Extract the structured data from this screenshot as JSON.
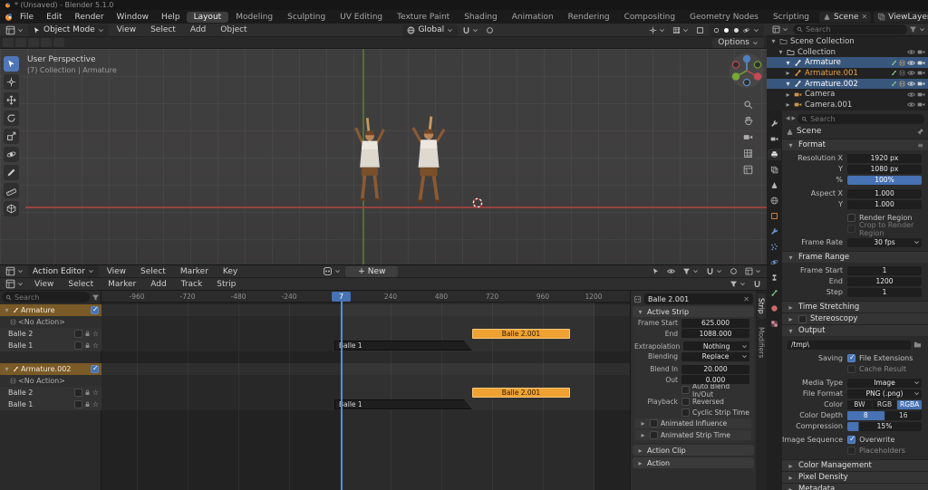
{
  "window": {
    "title": "* (Unsaved) - Blender 5.1.0"
  },
  "topbar": {
    "menus": [
      "File",
      "Edit",
      "Render",
      "Window",
      "Help"
    ],
    "workspaces": [
      "Layout",
      "Modeling",
      "Sculpting",
      "UV Editing",
      "Texture Paint",
      "Shading",
      "Animation",
      "Rendering",
      "Compositing",
      "Geometry Nodes",
      "Scripting"
    ],
    "active_workspace": "Layout",
    "scene_name": "Scene",
    "viewlayer_name": "ViewLayer"
  },
  "viewport": {
    "mode": "Object Mode",
    "menus": [
      "View",
      "Select",
      "Add",
      "Object"
    ],
    "orientation": "Global",
    "options_label": "Options",
    "overlay_line1": "User Perspective",
    "overlay_line2": "(7) Collection | Armature"
  },
  "outliner": {
    "search_placeholder": "Search",
    "rows": [
      {
        "label": "Scene Collection"
      },
      {
        "label": "Collection"
      },
      {
        "label": "Armature"
      },
      {
        "label": "Armature.001"
      },
      {
        "label": "Armature.002"
      },
      {
        "label": "Camera"
      },
      {
        "label": "Camera.001"
      }
    ]
  },
  "props": {
    "search_placeholder": "Search",
    "breadcrumb": "Scene",
    "format": {
      "title": "Format",
      "res_x_l": "Resolution X",
      "res_x": "1920 px",
      "res_y_l": "Y",
      "res_y": "1080 px",
      "pct_l": "%",
      "pct": "100%",
      "asp_x_l": "Aspect X",
      "asp_x": "1.000",
      "asp_y_l": "Y",
      "asp_y": "1.000",
      "render_region": "Render Region",
      "crop": "Crop to Render Region",
      "fps_l": "Frame Rate",
      "fps": "30 fps"
    },
    "range": {
      "title": "Frame Range",
      "start_l": "Frame Start",
      "start": "1",
      "end_l": "End",
      "end": "1200",
      "step_l": "Step",
      "step": "1"
    },
    "time_stretching": "Time Stretching",
    "stereoscopy": "Stereoscopy",
    "output": {
      "title": "Output",
      "path": "/tmp\\",
      "saving_l": "Saving",
      "file_ext": "File Extensions",
      "cache": "Cache Result",
      "media_l": "Media Type",
      "media": "Image",
      "format_l": "File Format",
      "format": "PNG (.png)",
      "color_l": "Color",
      "color_opts": [
        "BW",
        "RGB",
        "RGBA"
      ],
      "color_selected": "RGBA",
      "depth_l": "Color Depth",
      "depth_opts": [
        "8",
        "16"
      ],
      "depth_selected": "8",
      "comp_l": "Compression",
      "comp": "15%",
      "seq_l": "Image Sequence",
      "overwrite": "Overwrite",
      "placeholders": "Placeholders"
    },
    "color_management": "Color Management",
    "pixel_density": "Pixel Density",
    "metadata": "Metadata"
  },
  "ds": {
    "mode": "Action Editor",
    "menus": [
      "View",
      "Select",
      "Marker",
      "Key"
    ],
    "new_label": "New"
  },
  "nla": {
    "menus": [
      "View",
      "Select",
      "Marker",
      "Add",
      "Track",
      "Strip"
    ],
    "search_placeholder": "Search",
    "groups": [
      {
        "name": "Armature",
        "tracks": [
          "<No Action>",
          "Balle 2",
          "Balle 1"
        ]
      },
      {
        "name": "Armature.002",
        "tracks": [
          "<No Action>",
          "Balle 2",
          "Balle 1"
        ]
      }
    ],
    "ticks": [
      "-960",
      "-720",
      "-480",
      "-240",
      "240",
      "480",
      "720",
      "960",
      "1200"
    ],
    "playhead": "7",
    "strip_orange": "Balle 2.001",
    "strip_dark": "Balle 1"
  },
  "sb": {
    "tabs": [
      "Strip",
      "Modifiers"
    ],
    "name": "Balle 2.001",
    "as": {
      "title": "Active Strip",
      "fs_l": "Frame Start",
      "fs": "625.000",
      "end_l": "End",
      "end": "1088.000",
      "ex_l": "Extrapolation",
      "ex": "Nothing",
      "bl_l": "Blending",
      "bl": "Replace",
      "bi_l": "Blend In",
      "bi": "20.000",
      "out_l": "Out",
      "out": "0.000",
      "auto": "Auto Blend In/Out",
      "play_l": "Playback",
      "rev": "Reversed",
      "cyc": "Cyclic Strip Time",
      "ai": "Animated Influence",
      "ast": "Animated Strip Time"
    },
    "action_clip": "Action Clip",
    "action": "Action"
  },
  "icons": {
    "tri_down": "▾",
    "tri_right": "▸",
    "check": "✓",
    "star": "☆",
    "close": "✕",
    "plus": "+",
    "menu": "≡",
    "back": "◂",
    "fwd": "▸"
  },
  "colors": {
    "accent_blue": "#4772b3",
    "strip_orange": "#efa132",
    "selection_blue": "#39577d",
    "group_orange": "#7a5a26"
  }
}
